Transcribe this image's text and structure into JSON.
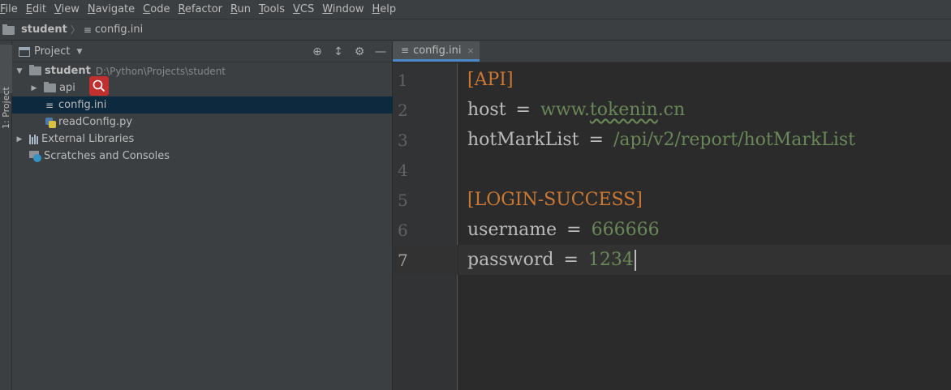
{
  "menubar": {
    "items": [
      {
        "mnemonic": "F",
        "rest": "ile"
      },
      {
        "mnemonic": "E",
        "rest": "dit"
      },
      {
        "mnemonic": "V",
        "rest": "iew"
      },
      {
        "mnemonic": "N",
        "rest": "avigate"
      },
      {
        "mnemonic": "C",
        "rest": "ode"
      },
      {
        "mnemonic": "R",
        "rest": "efactor"
      },
      {
        "mnemonic": "R",
        "rest": "un"
      },
      {
        "mnemonic": "T",
        "rest": "ools"
      },
      {
        "mnemonic": "V",
        "rest": "CS"
      },
      {
        "mnemonic": "W",
        "rest": "indow"
      },
      {
        "mnemonic": "H",
        "rest": "elp"
      }
    ]
  },
  "navbar": {
    "project": "student",
    "file": "config.ini"
  },
  "sidestrip": {
    "tab_label": "1: Project"
  },
  "project_panel": {
    "title": "Project",
    "tree": {
      "root_name": "student",
      "root_path": "D:\\Python\\Projects\\student",
      "api": "api",
      "config": "config.ini",
      "readconfig": "readConfig.py",
      "external": "External Libraries",
      "scratches": "Scratches and Consoles"
    }
  },
  "editor": {
    "tab_label": "config.ini",
    "line_numbers": [
      "1",
      "2",
      "3",
      "4",
      "5",
      "6",
      "7"
    ],
    "current_line": 7,
    "lines": {
      "l1_section": "[API]",
      "l2_key": "host",
      "l2_eq": "=",
      "l2_val_pre": "www.",
      "l2_val_typo": "tokenin",
      "l2_val_post": ".cn",
      "l3_key": "hotMarkList",
      "l3_eq": "=",
      "l3_val": "/api/v2/report/hotMarkList",
      "l5_section": "[LOGIN-SUCCESS]",
      "l6_key": "username",
      "l6_eq": "=",
      "l6_val": "666666",
      "l7_key": "password",
      "l7_eq": "=",
      "l7_val": "1234"
    }
  },
  "colors": {
    "section": "#cc7832",
    "value": "#6a8759",
    "selection": "#0d293e",
    "search_badge": "#c0302f"
  }
}
